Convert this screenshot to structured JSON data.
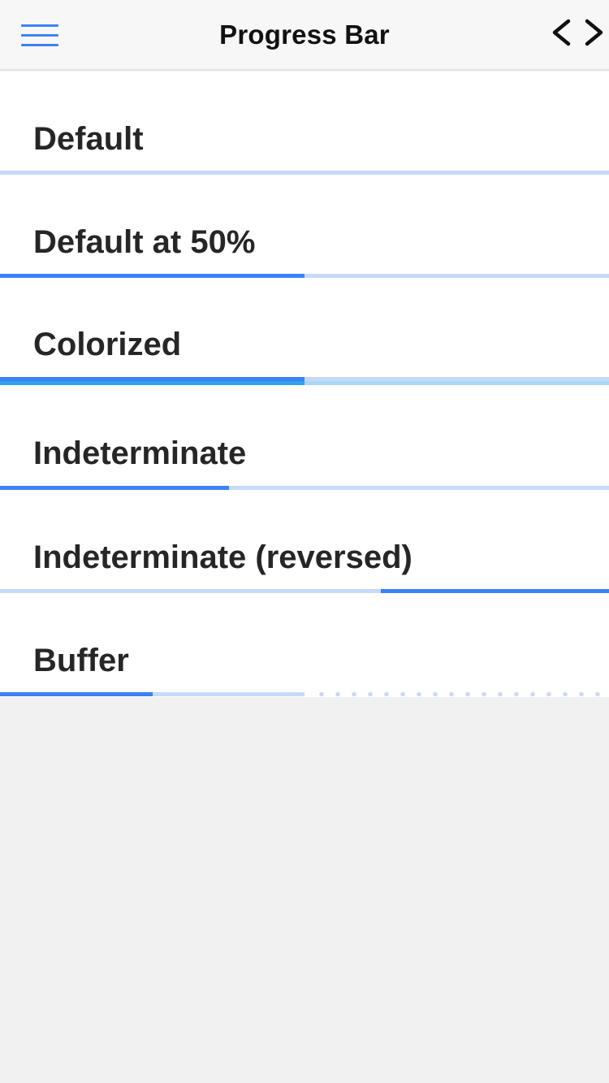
{
  "header": {
    "title": "Progress Bar",
    "menu_icon": "hamburger-menu-icon",
    "code_icon": "code-brackets-icon"
  },
  "colors": {
    "accent": "#3b82f6",
    "track": "#c5daf8",
    "colorized_track": "#a9d8f7"
  },
  "examples": [
    {
      "label": "Default",
      "progress": 0
    },
    {
      "label": "Default at 50%",
      "progress": 0.5
    },
    {
      "label": "Colorized",
      "progress": 0.5
    },
    {
      "label": "Indeterminate",
      "state": "indeterminate"
    },
    {
      "label": "Indeterminate (reversed)",
      "state": "indeterminate-reversed"
    },
    {
      "label": "Buffer",
      "progress": 0.25,
      "buffer": 0.5
    }
  ]
}
